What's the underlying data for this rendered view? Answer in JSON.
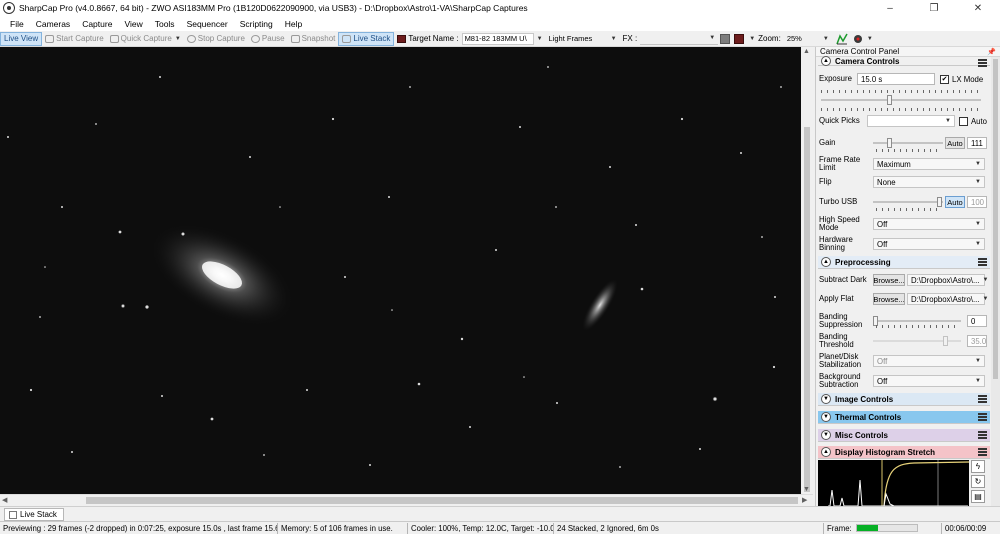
{
  "window": {
    "title": "SharpCap Pro (v4.0.8667, 64 bit) - ZWO ASI183MM Pro (1B120D0622090900, via USB3) - D:\\Dropbox\\Astro\\1-VA\\SharpCap Captures",
    "minimize": "–",
    "maximize": "❐",
    "close": "✕"
  },
  "menu": [
    "File",
    "Cameras",
    "Capture",
    "View",
    "Tools",
    "Sequencer",
    "Scripting",
    "Help"
  ],
  "toolbar": {
    "live_view": "Live View",
    "start_capture": "Start Capture",
    "quick_capture": "Quick Capture",
    "stop_capture": "Stop Capture",
    "pause": "Pause",
    "snapshot": "Snapshot",
    "live_stack": "Live Stack",
    "target_label": "Target Name :",
    "target_value": "M81-82 183MM U\\",
    "frame_type": "Light Frames",
    "fx_label": "FX :",
    "zoom_label": "Zoom:",
    "zoom_value": "25%"
  },
  "panel": {
    "title": "Camera Control Panel",
    "camera_controls": {
      "header": "Camera Controls",
      "exposure_label": "Exposure",
      "exposure_value": "15.0 s",
      "lx_mode_label": "LX Mode",
      "quick_picks_label": "Quick Picks",
      "auto_label": "Auto",
      "gain_label": "Gain",
      "gain_auto": "Auto",
      "gain_value": "111",
      "frame_rate_label": "Frame Rate Limit",
      "frame_rate_value": "Maximum",
      "flip_label": "Flip",
      "flip_value": "None",
      "turbo_label": "Turbo USB",
      "turbo_auto": "Auto",
      "turbo_value": "100",
      "high_speed_label": "High Speed Mode",
      "high_speed_value": "Off",
      "binning_label": "Hardware Binning",
      "binning_value": "Off"
    },
    "preprocessing": {
      "header": "Preprocessing",
      "dark_label": "Subtract Dark",
      "dark_browse": "Browse...",
      "dark_path": "D:\\Dropbox\\Astro\\...",
      "flat_label": "Apply Flat",
      "flat_browse": "Browse...",
      "flat_path": "D:\\Dropbox\\Astro\\...",
      "banding_supp_label": "Banding Suppression",
      "banding_supp_value": "0",
      "banding_thr_label": "Banding Threshold",
      "banding_thr_value": "35.0",
      "planet_label": "Planet/Disk Stabilization",
      "planet_value": "Off",
      "bg_label": "Background Subtraction",
      "bg_value": "Off"
    },
    "image_controls": "Image Controls",
    "thermal_controls": "Thermal Controls",
    "misc_controls": "Misc Controls",
    "histogram": "Display Histogram Stretch"
  },
  "tabs": {
    "live_stack": "Live Stack"
  },
  "status": {
    "previewing": "Previewing : 29 frames (-2 dropped) in 0:07:25, exposure 15.0s , last frame 15.6s",
    "memory": "Memory: 5 of 106 frames in use.",
    "cooler": "Cooler: 100%, Temp: 12.0C, Target: -10.0C",
    "stacked": "24 Stacked, 2 Ignored, 6m 0s",
    "frame_label": "Frame:",
    "frame_progress": 0.35,
    "time": "00:06/00:09"
  },
  "colors": {
    "image_controls": "#dbe8f4",
    "thermal_controls": "#88c7ee",
    "misc_controls": "#ddd0e8",
    "histogram": "#f4c3c8",
    "camera_controls": "#f0f0f0",
    "preprocessing": "#e3ecf6"
  }
}
